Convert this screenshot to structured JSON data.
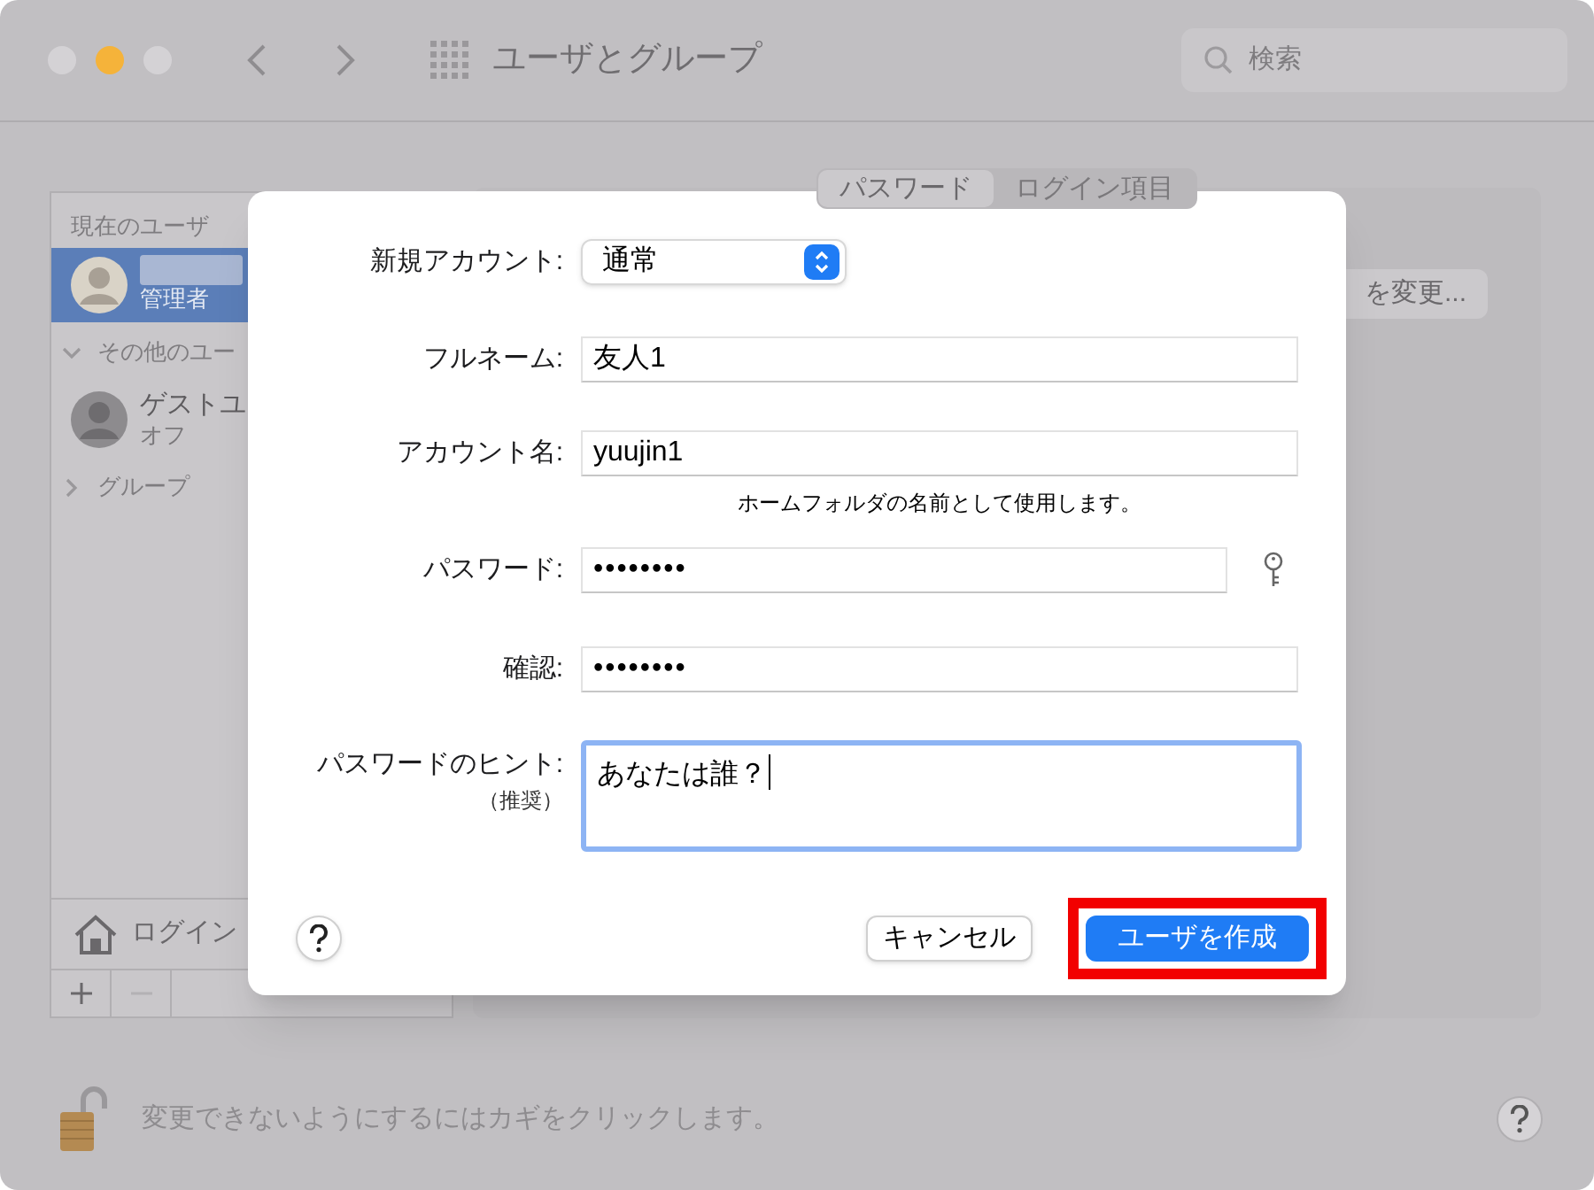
{
  "window": {
    "title": "ユーザとグループ",
    "search_placeholder": "検索"
  },
  "sidebar": {
    "groups": [
      {
        "label": "現在のユーザ",
        "kind": "header",
        "users": [
          {
            "role": "管理者",
            "selected": true
          }
        ]
      },
      {
        "label": "その他のユー",
        "kind": "disclosure",
        "expanded": true,
        "users": [
          {
            "name": "ゲストユ",
            "status": "オフ",
            "selected": false
          }
        ]
      },
      {
        "label": "グループ",
        "kind": "disclosure",
        "expanded": false
      }
    ],
    "login_options": "ログイン"
  },
  "tabs": [
    {
      "label": "パスワード",
      "selected": true
    },
    {
      "label": "ログイン項目",
      "selected": false
    }
  ],
  "change_button": "を変更...",
  "lock": {
    "locked": false,
    "message": "変更できないようにするにはカギをクリックします。"
  },
  "sheet": {
    "rows": [
      {
        "kind": "popup",
        "label": "新規アカウント:",
        "value": "通常"
      },
      {
        "kind": "text",
        "label": "フルネーム:",
        "value": "友人1"
      },
      {
        "kind": "text",
        "label": "アカウント名:",
        "value": "yuujin1",
        "note": "ホームフォルダの名前として使用します。"
      },
      {
        "kind": "password",
        "label": "パスワード:",
        "value": "••••••••",
        "key_button": true
      },
      {
        "kind": "password",
        "label": "確認:",
        "value": "••••••••"
      },
      {
        "kind": "textarea",
        "label": "パスワードのヒント:",
        "sublabel": "（推奨）",
        "value": "あなたは誰？",
        "focused": true
      }
    ],
    "buttons": [
      {
        "label": "キャンセル",
        "kind": "secondary",
        "highlighted": false
      },
      {
        "label": "ユーザを作成",
        "kind": "primary",
        "highlighted": true
      }
    ]
  }
}
